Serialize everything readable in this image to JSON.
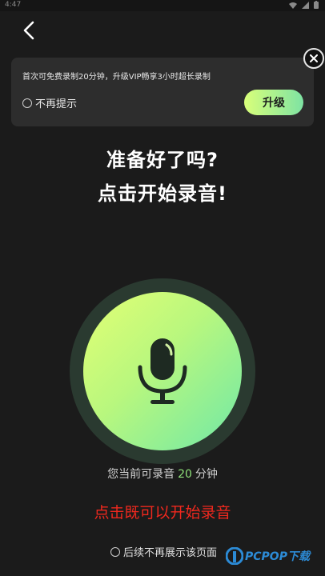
{
  "status_bar": {
    "time": "4:47"
  },
  "banner": {
    "text": "首次可免费录制20分钟，升级VIP畅享3小时超长录制",
    "dont_remind_label": "不再提示",
    "upgrade_label": "升级"
  },
  "headline": {
    "line1": "准备好了吗?",
    "line2": "点击开始录音!"
  },
  "remaining": {
    "prefix": "您当前可录音",
    "minutes": "20",
    "suffix": "分钟"
  },
  "hint": "点击既可以开始录音",
  "no_show_label": "后续不再展示该页面",
  "watermark": {
    "text": "PCPOP下载"
  },
  "colors": {
    "background": "#1b1b1b",
    "banner": "#2d2d2d",
    "accent_green": "#8fe27a",
    "hint_red": "#f0281e"
  },
  "icons": {
    "back": "chevron-left-icon",
    "close": "close-icon",
    "mic": "microphone-icon"
  }
}
